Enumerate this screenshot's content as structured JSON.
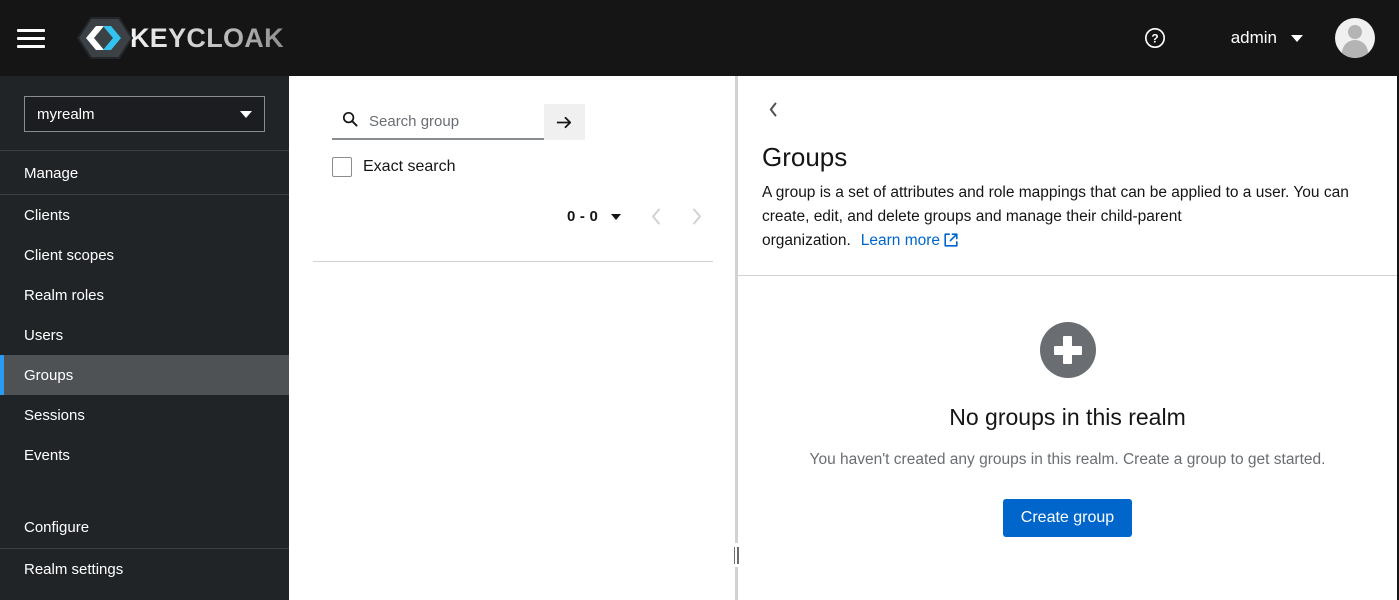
{
  "masthead": {
    "hamburger_label": "Global navigation",
    "brand_text": "KEYCLOAK",
    "help_label": "?",
    "user_name": "admin"
  },
  "sidebar": {
    "realm": {
      "selected": "myrealm"
    },
    "groups": [
      {
        "section_label": "Manage",
        "items": [
          {
            "label": "Clients",
            "active": false
          },
          {
            "label": "Client scopes",
            "active": false
          },
          {
            "label": "Realm roles",
            "active": false
          },
          {
            "label": "Users",
            "active": false
          },
          {
            "label": "Groups",
            "active": true
          },
          {
            "label": "Sessions",
            "active": false
          },
          {
            "label": "Events",
            "active": false
          }
        ]
      },
      {
        "section_label": "Configure",
        "items": [
          {
            "label": "Realm settings",
            "active": false
          }
        ]
      }
    ]
  },
  "left_pane": {
    "search": {
      "placeholder": "Search group",
      "value": "",
      "search_icon": "search-icon",
      "submit_icon": "arrow-right-icon"
    },
    "exact_search": {
      "label": "Exact search",
      "checked": false
    },
    "pagination": {
      "count_label": "0 - 0",
      "prev_icon": "chevron-left-icon",
      "next_icon": "chevron-right-icon",
      "prev_enabled": false,
      "next_enabled": false
    }
  },
  "main": {
    "back_icon": "chevron-left-icon",
    "title": "Groups",
    "description": "A group is a set of attributes and role mappings that can be applied to a user. You can create, edit, and delete groups and manage their child-parent organization.",
    "learn_more_label": "Learn more",
    "learn_more_icon": "external-link-icon",
    "empty_state": {
      "icon": "plus-circle-icon",
      "title": "No groups in this realm",
      "description": "You haven't created any groups in this realm. Create a group to get started.",
      "cta_label": "Create group"
    }
  },
  "colors": {
    "masthead_bg": "#151515",
    "sidebar_bg": "#212427",
    "sidebar_active_bg": "#4f5255",
    "sidebar_active_accent": "#2b9af3",
    "link": "#0066cc",
    "primary_button": "#0066cc",
    "empty_icon": "#6a6e73",
    "logo_accent": "#33c3f0"
  }
}
